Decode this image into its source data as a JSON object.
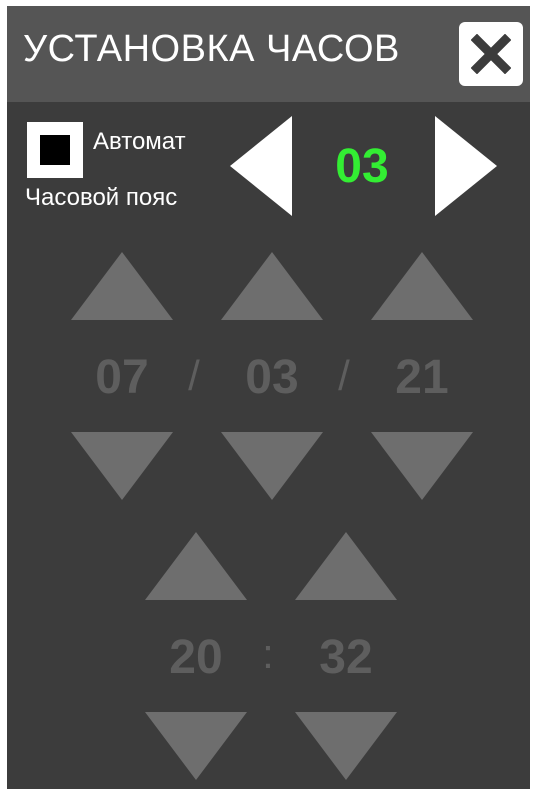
{
  "header": {
    "title": "УСТАНОВКА ЧАСОВ"
  },
  "auto": {
    "label": "Автомат",
    "checked": true
  },
  "timezone": {
    "label": "Часовой пояс",
    "value": "03",
    "value_color": "#33ee33"
  },
  "date": {
    "day": "07",
    "month": "03",
    "year": "21",
    "separator": "/"
  },
  "time": {
    "hours": "20",
    "minutes": "32",
    "separator": ":"
  },
  "colors": {
    "panel_bg": "#3c3c3c",
    "header_bg": "#555555",
    "disabled_control": "#6e6e6e",
    "disabled_text": "#5e5e5e"
  }
}
